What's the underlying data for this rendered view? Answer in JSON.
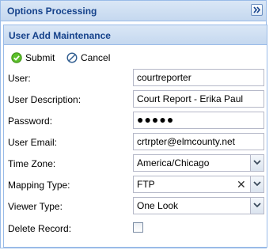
{
  "outer": {
    "title": "Options Processing",
    "collapse_icon": "double-chevron-right-icon"
  },
  "panel": {
    "title": "User Add Maintenance"
  },
  "toolbar": {
    "submit_label": "Submit",
    "submit_icon": "check-circle-icon",
    "cancel_label": "Cancel",
    "cancel_icon": "cancel-circle-icon",
    "submit_icon_color": "#4caf1e",
    "cancel_icon_color": "#2f5c8f"
  },
  "form": {
    "user": {
      "label": "User:",
      "value": "courtreporter"
    },
    "description": {
      "label": "User Description:",
      "value": "Court Report - Erika Paul"
    },
    "password": {
      "label": "Password:",
      "value": "●●●●●"
    },
    "email": {
      "label": "User Email:",
      "value": "crtrpter@elmcounty.net"
    },
    "time_zone": {
      "label": "Time Zone:",
      "value": "America/Chicago"
    },
    "mapping_type": {
      "label": "Mapping Type:",
      "value": "FTP",
      "clear_icon": "✕"
    },
    "viewer_type": {
      "label": "Viewer Type:",
      "value": "One Look"
    },
    "delete_record": {
      "label": "Delete Record:",
      "checked": false
    }
  },
  "colors": {
    "header_text": "#15428b",
    "border": "#99bbe8",
    "field_border": "#b5b8c8"
  }
}
